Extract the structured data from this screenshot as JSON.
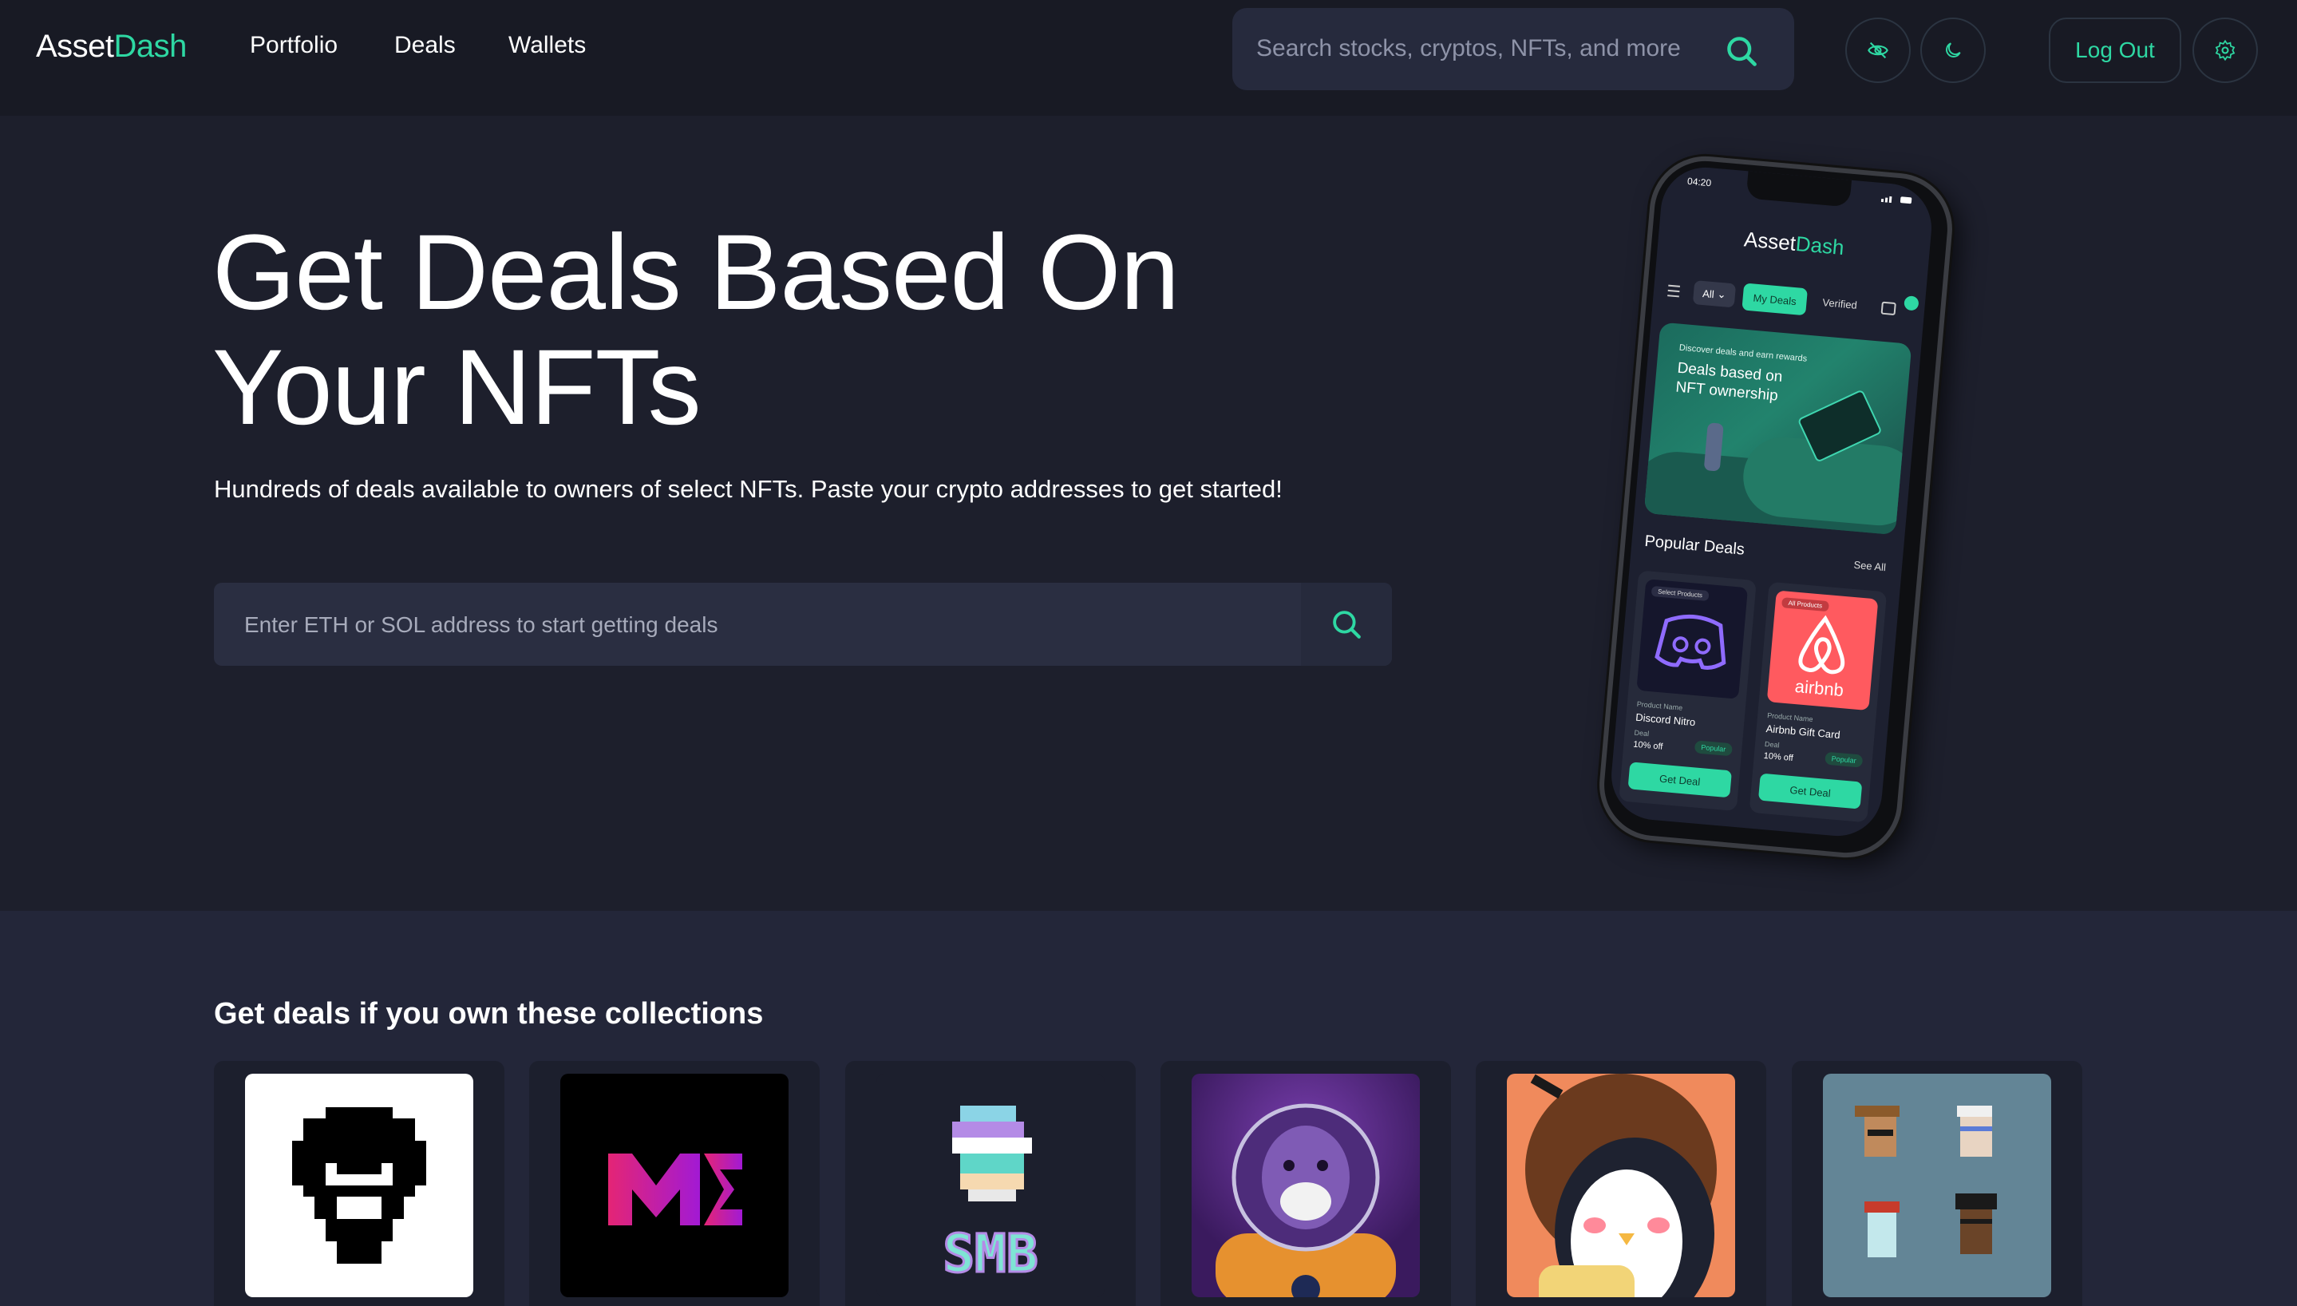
{
  "brand": {
    "name_prefix": "Asset",
    "name_suffix": "Dash",
    "accent_color": "#2ed8a3"
  },
  "nav": {
    "links": [
      "Portfolio",
      "Deals",
      "Wallets"
    ]
  },
  "search": {
    "placeholder": "Search stocks, cryptos, NFTs, and more"
  },
  "header_actions": {
    "hide_icon": "eye-slash-icon",
    "theme_icon": "moon-icon",
    "logout_label": "Log Out",
    "settings_icon": "gear-icon"
  },
  "hero": {
    "title": "Get Deals Based On Your NFTs",
    "subtitle": "Hundreds of deals available to owners of select NFTs. Paste your crypto addresses to get started!",
    "address_placeholder": "Enter ETH or SOL address to start getting deals"
  },
  "phone": {
    "time": "04:20",
    "logo_prefix": "Asset",
    "logo_suffix": "Dash",
    "filter_all": "All",
    "filter_mydeals": "My Deals",
    "filter_verified": "Verified",
    "banner_small": "Discover deals and earn rewards",
    "banner_big": "Deals based on NFT ownership",
    "popular_title": "Popular Deals",
    "see_all": "See All",
    "deals": [
      {
        "tag": "Select Products",
        "product_label": "Product Name",
        "name": "Discord Nitro",
        "deal_label": "Deal",
        "deal": "10% off",
        "badge": "Popular",
        "button": "Get Deal"
      },
      {
        "tag": "All Products",
        "product_label": "Product Name",
        "name": "Airbnb Gift Card",
        "deal_label": "Deal",
        "deal": "10% off",
        "badge": "Popular",
        "button": "Get Deal",
        "logo_text": "airbnb"
      }
    ]
  },
  "collections": {
    "title": "Get deals if you own these collections",
    "items": [
      {
        "icon": "pixel-face-logo"
      },
      {
        "icon": "magic-eden-logo",
        "text": "ME"
      },
      {
        "icon": "smb-logo",
        "text": "SMB"
      },
      {
        "icon": "astronaut-ape-art"
      },
      {
        "icon": "pudgy-penguin-art"
      },
      {
        "icon": "cryptopunks-grid-art"
      }
    ]
  }
}
